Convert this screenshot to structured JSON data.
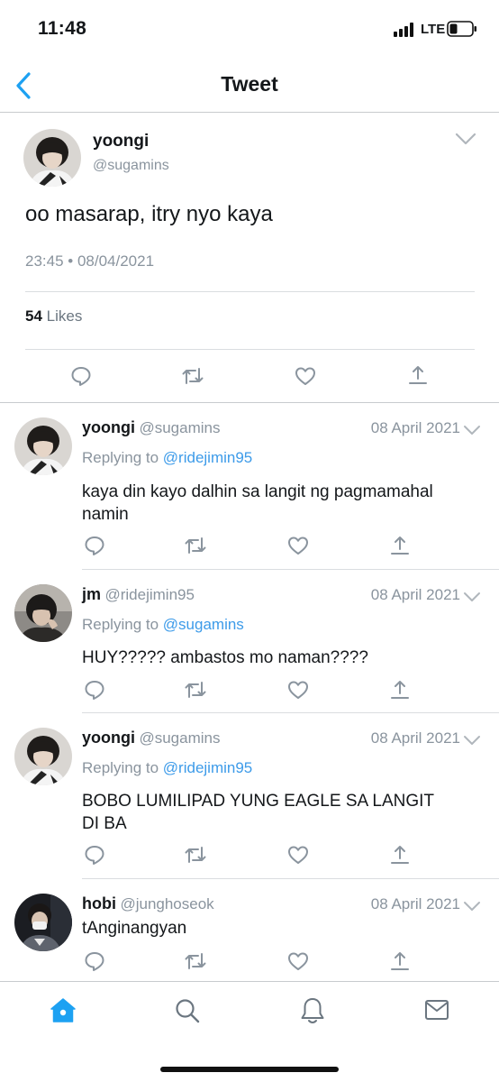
{
  "status_bar": {
    "time": "11:48",
    "network": "LTE"
  },
  "nav": {
    "title": "Tweet"
  },
  "main_tweet": {
    "name": "yoongi",
    "handle": "@sugamins",
    "text": "oo masarap, itry nyo kaya",
    "meta": "23:45 • 08/04/2021",
    "likes_count": "54",
    "likes_label": "Likes"
  },
  "replies": [
    {
      "name": "yoongi",
      "handle": "@sugamins",
      "date": "08 April 2021",
      "replying_label": "Replying to",
      "replying_to": "@ridejimin95",
      "text_lines": [
        "kaya din kayo dalhin sa langit ng pagmamahal",
        "namin"
      ]
    },
    {
      "name": "jm",
      "handle": "@ridejimin95",
      "date": "08 April 2021",
      "replying_label": "Replying to",
      "replying_to": "@sugamins",
      "text_lines": [
        "HUY????? ambastos mo naman????"
      ]
    },
    {
      "name": "yoongi",
      "handle": "@sugamins",
      "date": "08 April 2021",
      "replying_label": "Replying to",
      "replying_to": "@ridejimin95",
      "text_lines": [
        "BOBO LUMILIPAD YUNG EAGLE SA LANGIT",
        "DI BA"
      ]
    },
    {
      "name": "hobi",
      "handle": "@junghoseok",
      "date": "08 April 2021",
      "text_lines": [
        "tAnginangyan"
      ]
    }
  ],
  "icons": {
    "back": "chevron-left-icon",
    "more": "chevron-down-icon",
    "reply": "reply-icon",
    "retweet": "retweet-icon",
    "like": "heart-icon",
    "share": "share-icon",
    "tabs": [
      "home-icon",
      "search-icon",
      "notifications-icon",
      "messages-icon"
    ]
  },
  "colors": {
    "accent": "#1da1f2",
    "mention": "#3d9be9",
    "muted": "#8a949e"
  }
}
